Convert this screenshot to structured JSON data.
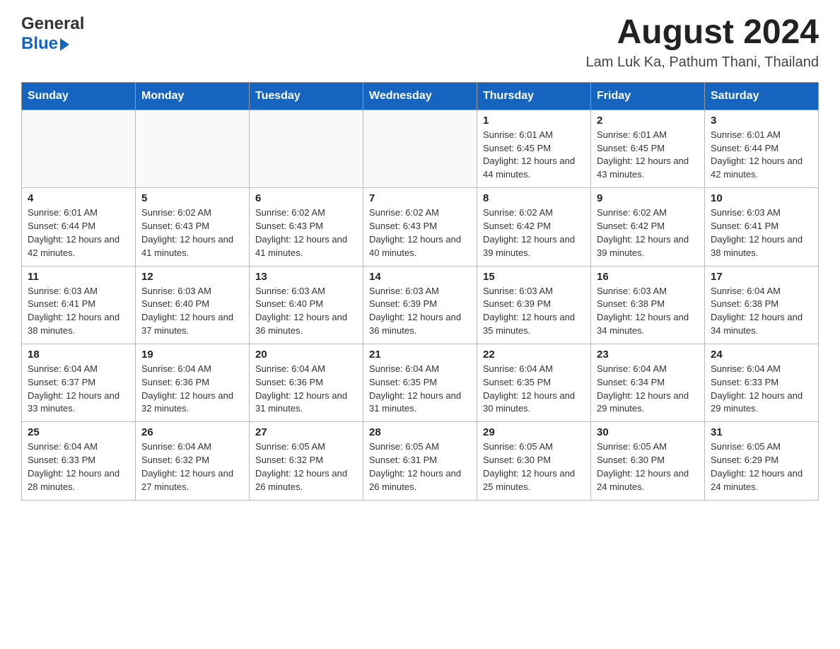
{
  "header": {
    "logo_general": "General",
    "logo_blue": "Blue",
    "month_year": "August 2024",
    "location": "Lam Luk Ka, Pathum Thani, Thailand"
  },
  "weekdays": [
    "Sunday",
    "Monday",
    "Tuesday",
    "Wednesday",
    "Thursday",
    "Friday",
    "Saturday"
  ],
  "weeks": [
    [
      {
        "day": "",
        "info": ""
      },
      {
        "day": "",
        "info": ""
      },
      {
        "day": "",
        "info": ""
      },
      {
        "day": "",
        "info": ""
      },
      {
        "day": "1",
        "info": "Sunrise: 6:01 AM\nSunset: 6:45 PM\nDaylight: 12 hours and 44 minutes."
      },
      {
        "day": "2",
        "info": "Sunrise: 6:01 AM\nSunset: 6:45 PM\nDaylight: 12 hours and 43 minutes."
      },
      {
        "day": "3",
        "info": "Sunrise: 6:01 AM\nSunset: 6:44 PM\nDaylight: 12 hours and 42 minutes."
      }
    ],
    [
      {
        "day": "4",
        "info": "Sunrise: 6:01 AM\nSunset: 6:44 PM\nDaylight: 12 hours and 42 minutes."
      },
      {
        "day": "5",
        "info": "Sunrise: 6:02 AM\nSunset: 6:43 PM\nDaylight: 12 hours and 41 minutes."
      },
      {
        "day": "6",
        "info": "Sunrise: 6:02 AM\nSunset: 6:43 PM\nDaylight: 12 hours and 41 minutes."
      },
      {
        "day": "7",
        "info": "Sunrise: 6:02 AM\nSunset: 6:43 PM\nDaylight: 12 hours and 40 minutes."
      },
      {
        "day": "8",
        "info": "Sunrise: 6:02 AM\nSunset: 6:42 PM\nDaylight: 12 hours and 39 minutes."
      },
      {
        "day": "9",
        "info": "Sunrise: 6:02 AM\nSunset: 6:42 PM\nDaylight: 12 hours and 39 minutes."
      },
      {
        "day": "10",
        "info": "Sunrise: 6:03 AM\nSunset: 6:41 PM\nDaylight: 12 hours and 38 minutes."
      }
    ],
    [
      {
        "day": "11",
        "info": "Sunrise: 6:03 AM\nSunset: 6:41 PM\nDaylight: 12 hours and 38 minutes."
      },
      {
        "day": "12",
        "info": "Sunrise: 6:03 AM\nSunset: 6:40 PM\nDaylight: 12 hours and 37 minutes."
      },
      {
        "day": "13",
        "info": "Sunrise: 6:03 AM\nSunset: 6:40 PM\nDaylight: 12 hours and 36 minutes."
      },
      {
        "day": "14",
        "info": "Sunrise: 6:03 AM\nSunset: 6:39 PM\nDaylight: 12 hours and 36 minutes."
      },
      {
        "day": "15",
        "info": "Sunrise: 6:03 AM\nSunset: 6:39 PM\nDaylight: 12 hours and 35 minutes."
      },
      {
        "day": "16",
        "info": "Sunrise: 6:03 AM\nSunset: 6:38 PM\nDaylight: 12 hours and 34 minutes."
      },
      {
        "day": "17",
        "info": "Sunrise: 6:04 AM\nSunset: 6:38 PM\nDaylight: 12 hours and 34 minutes."
      }
    ],
    [
      {
        "day": "18",
        "info": "Sunrise: 6:04 AM\nSunset: 6:37 PM\nDaylight: 12 hours and 33 minutes."
      },
      {
        "day": "19",
        "info": "Sunrise: 6:04 AM\nSunset: 6:36 PM\nDaylight: 12 hours and 32 minutes."
      },
      {
        "day": "20",
        "info": "Sunrise: 6:04 AM\nSunset: 6:36 PM\nDaylight: 12 hours and 31 minutes."
      },
      {
        "day": "21",
        "info": "Sunrise: 6:04 AM\nSunset: 6:35 PM\nDaylight: 12 hours and 31 minutes."
      },
      {
        "day": "22",
        "info": "Sunrise: 6:04 AM\nSunset: 6:35 PM\nDaylight: 12 hours and 30 minutes."
      },
      {
        "day": "23",
        "info": "Sunrise: 6:04 AM\nSunset: 6:34 PM\nDaylight: 12 hours and 29 minutes."
      },
      {
        "day": "24",
        "info": "Sunrise: 6:04 AM\nSunset: 6:33 PM\nDaylight: 12 hours and 29 minutes."
      }
    ],
    [
      {
        "day": "25",
        "info": "Sunrise: 6:04 AM\nSunset: 6:33 PM\nDaylight: 12 hours and 28 minutes."
      },
      {
        "day": "26",
        "info": "Sunrise: 6:04 AM\nSunset: 6:32 PM\nDaylight: 12 hours and 27 minutes."
      },
      {
        "day": "27",
        "info": "Sunrise: 6:05 AM\nSunset: 6:32 PM\nDaylight: 12 hours and 26 minutes."
      },
      {
        "day": "28",
        "info": "Sunrise: 6:05 AM\nSunset: 6:31 PM\nDaylight: 12 hours and 26 minutes."
      },
      {
        "day": "29",
        "info": "Sunrise: 6:05 AM\nSunset: 6:30 PM\nDaylight: 12 hours and 25 minutes."
      },
      {
        "day": "30",
        "info": "Sunrise: 6:05 AM\nSunset: 6:30 PM\nDaylight: 12 hours and 24 minutes."
      },
      {
        "day": "31",
        "info": "Sunrise: 6:05 AM\nSunset: 6:29 PM\nDaylight: 12 hours and 24 minutes."
      }
    ]
  ]
}
